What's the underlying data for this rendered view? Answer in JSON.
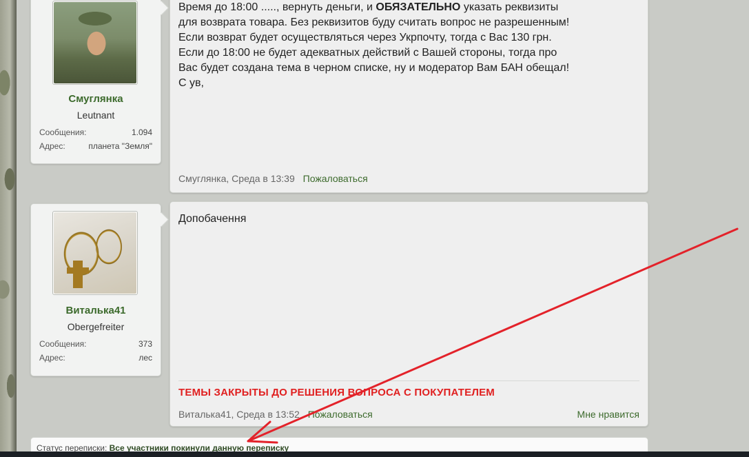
{
  "posts": [
    {
      "user": {
        "name": "Смуглянка",
        "rank": "Leutnant",
        "stats": [
          {
            "label": "Сообщения:",
            "value": "1.094"
          },
          {
            "label": "Адрес:",
            "value": "планета \"Земля\""
          }
        ]
      },
      "text_lines": [
        "Время до 18:00 ....., вернуть деньги, и ",
        "для возврата товара. Без реквизитов буду считать вопрос не разрешенным!",
        "Если возврат будет осуществляться через Укрпочту, тогда с Вас 130 грн.",
        "Если до 18:00 не будет адекватных действий с Вашей стороны, тогда про",
        "Вас будет создана тема в черном списке, ну и модератор Вам БАН обещал!",
        "С ув,"
      ],
      "bold_word": "ОБЯЗАТЕЛЬНО",
      "line1_tail": " указать реквизиты",
      "author_time": "Смуглянка, Среда в 13:39",
      "report_label": "Пожаловаться"
    },
    {
      "user": {
        "name": "Виталька41",
        "rank": "Obergefreiter",
        "stats": [
          {
            "label": "Сообщения:",
            "value": "373"
          },
          {
            "label": "Адрес:",
            "value": "лес"
          }
        ]
      },
      "text": "Допобачення",
      "signature": "ТЕМЫ ЗАКРЫТЫ ДО РЕШЕНИЯ ВОПРОСА С ПОКУПАТЕЛЕМ",
      "author_time": "Виталька41, Среда в 13:52",
      "report_label": "Пожаловаться",
      "like_label": "Мне нравится"
    }
  ],
  "status": {
    "label": "Статус переписки:",
    "value": "Все участники покинули данную переписку"
  },
  "colors": {
    "username": "#3c6a2c",
    "signature": "#e02020",
    "annotation_arrow": "#e3222a"
  }
}
